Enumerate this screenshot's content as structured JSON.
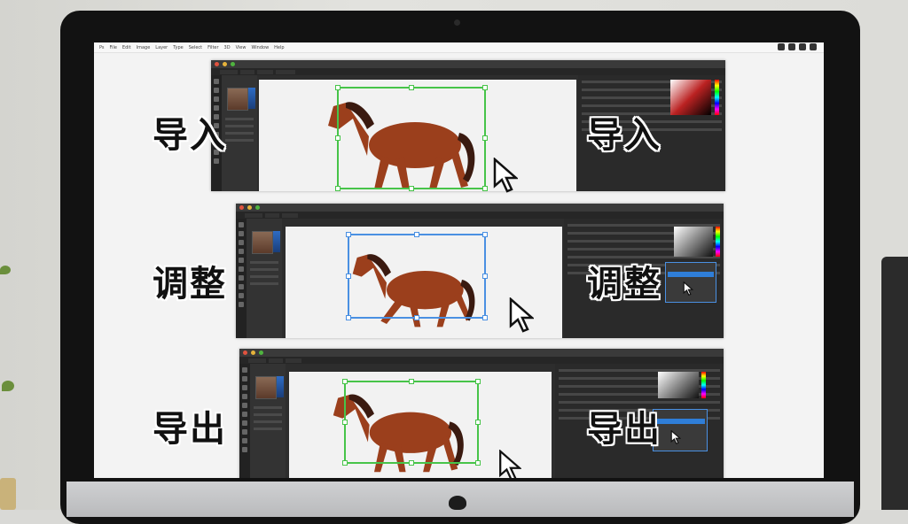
{
  "mac_menubar": {
    "items": [
      "Ps",
      "File",
      "Edit",
      "Image",
      "Layer",
      "Type",
      "Select",
      "Filter",
      "3D",
      "View",
      "Window",
      "Help"
    ]
  },
  "steps": [
    {
      "left_label": "导入",
      "right_label": "导入",
      "selection_color": "#47c449"
    },
    {
      "left_label": "调整",
      "right_label": "调整",
      "selection_color": "#4a90e2"
    },
    {
      "left_label": "导出",
      "right_label": "导出",
      "selection_color": "#47c449"
    }
  ],
  "colors": {
    "accent_green": "#47c449",
    "accent_blue": "#4a90e2",
    "horse": "#9b3f1c"
  },
  "icons": [
    "cursor-arrow-icon",
    "apple-logo-icon",
    "traffic-light-icon"
  ]
}
